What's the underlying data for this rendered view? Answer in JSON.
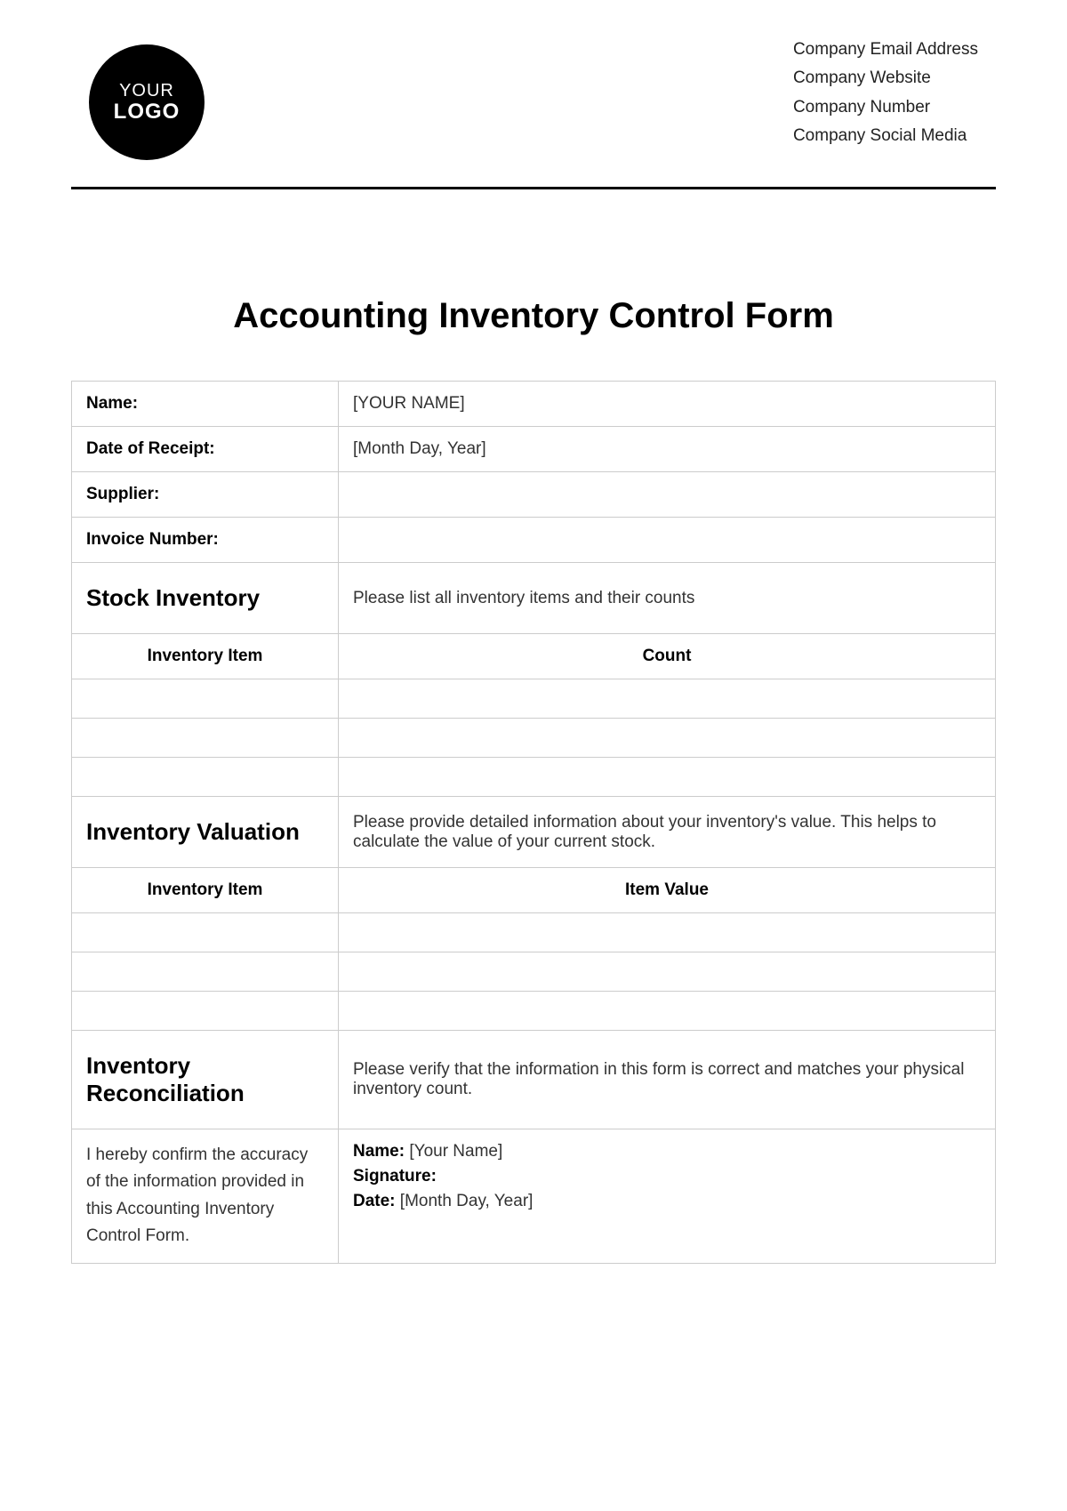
{
  "logo": {
    "line1": "YOUR",
    "line2": "LOGO"
  },
  "company": {
    "email": "Company Email Address",
    "website": "Company Website",
    "number": "Company Number",
    "social": "Company Social Media"
  },
  "title": "Accounting Inventory Control Form",
  "fields": {
    "name_label": "Name:",
    "name_value": "[YOUR NAME]",
    "date_label": "Date of Receipt:",
    "date_value": "[Month Day, Year]",
    "supplier_label": "Supplier:",
    "supplier_value": "",
    "invoice_label": "Invoice Number:",
    "invoice_value": ""
  },
  "stock": {
    "heading": "Stock Inventory",
    "instruction": "Please list all inventory items and their counts",
    "col1": "Inventory Item",
    "col2": "Count"
  },
  "valuation": {
    "heading": "Inventory Valuation",
    "instruction": "Please provide detailed information about your inventory's value. This helps to calculate the value of your current stock.",
    "col1": "Inventory Item",
    "col2": "Item Value"
  },
  "reconciliation": {
    "heading": "Inventory Reconciliation",
    "instruction": "Please verify that the information in this form is correct and matches your physical inventory count.",
    "confirm": "I hereby confirm the accuracy of the information provided in this Accounting Inventory Control Form.",
    "name_label": "Name:",
    "name_value": " [Your Name]",
    "sig_label": "Signature:",
    "sig_value": "",
    "date_label": "Date:",
    "date_value": " [Month Day, Year]"
  }
}
